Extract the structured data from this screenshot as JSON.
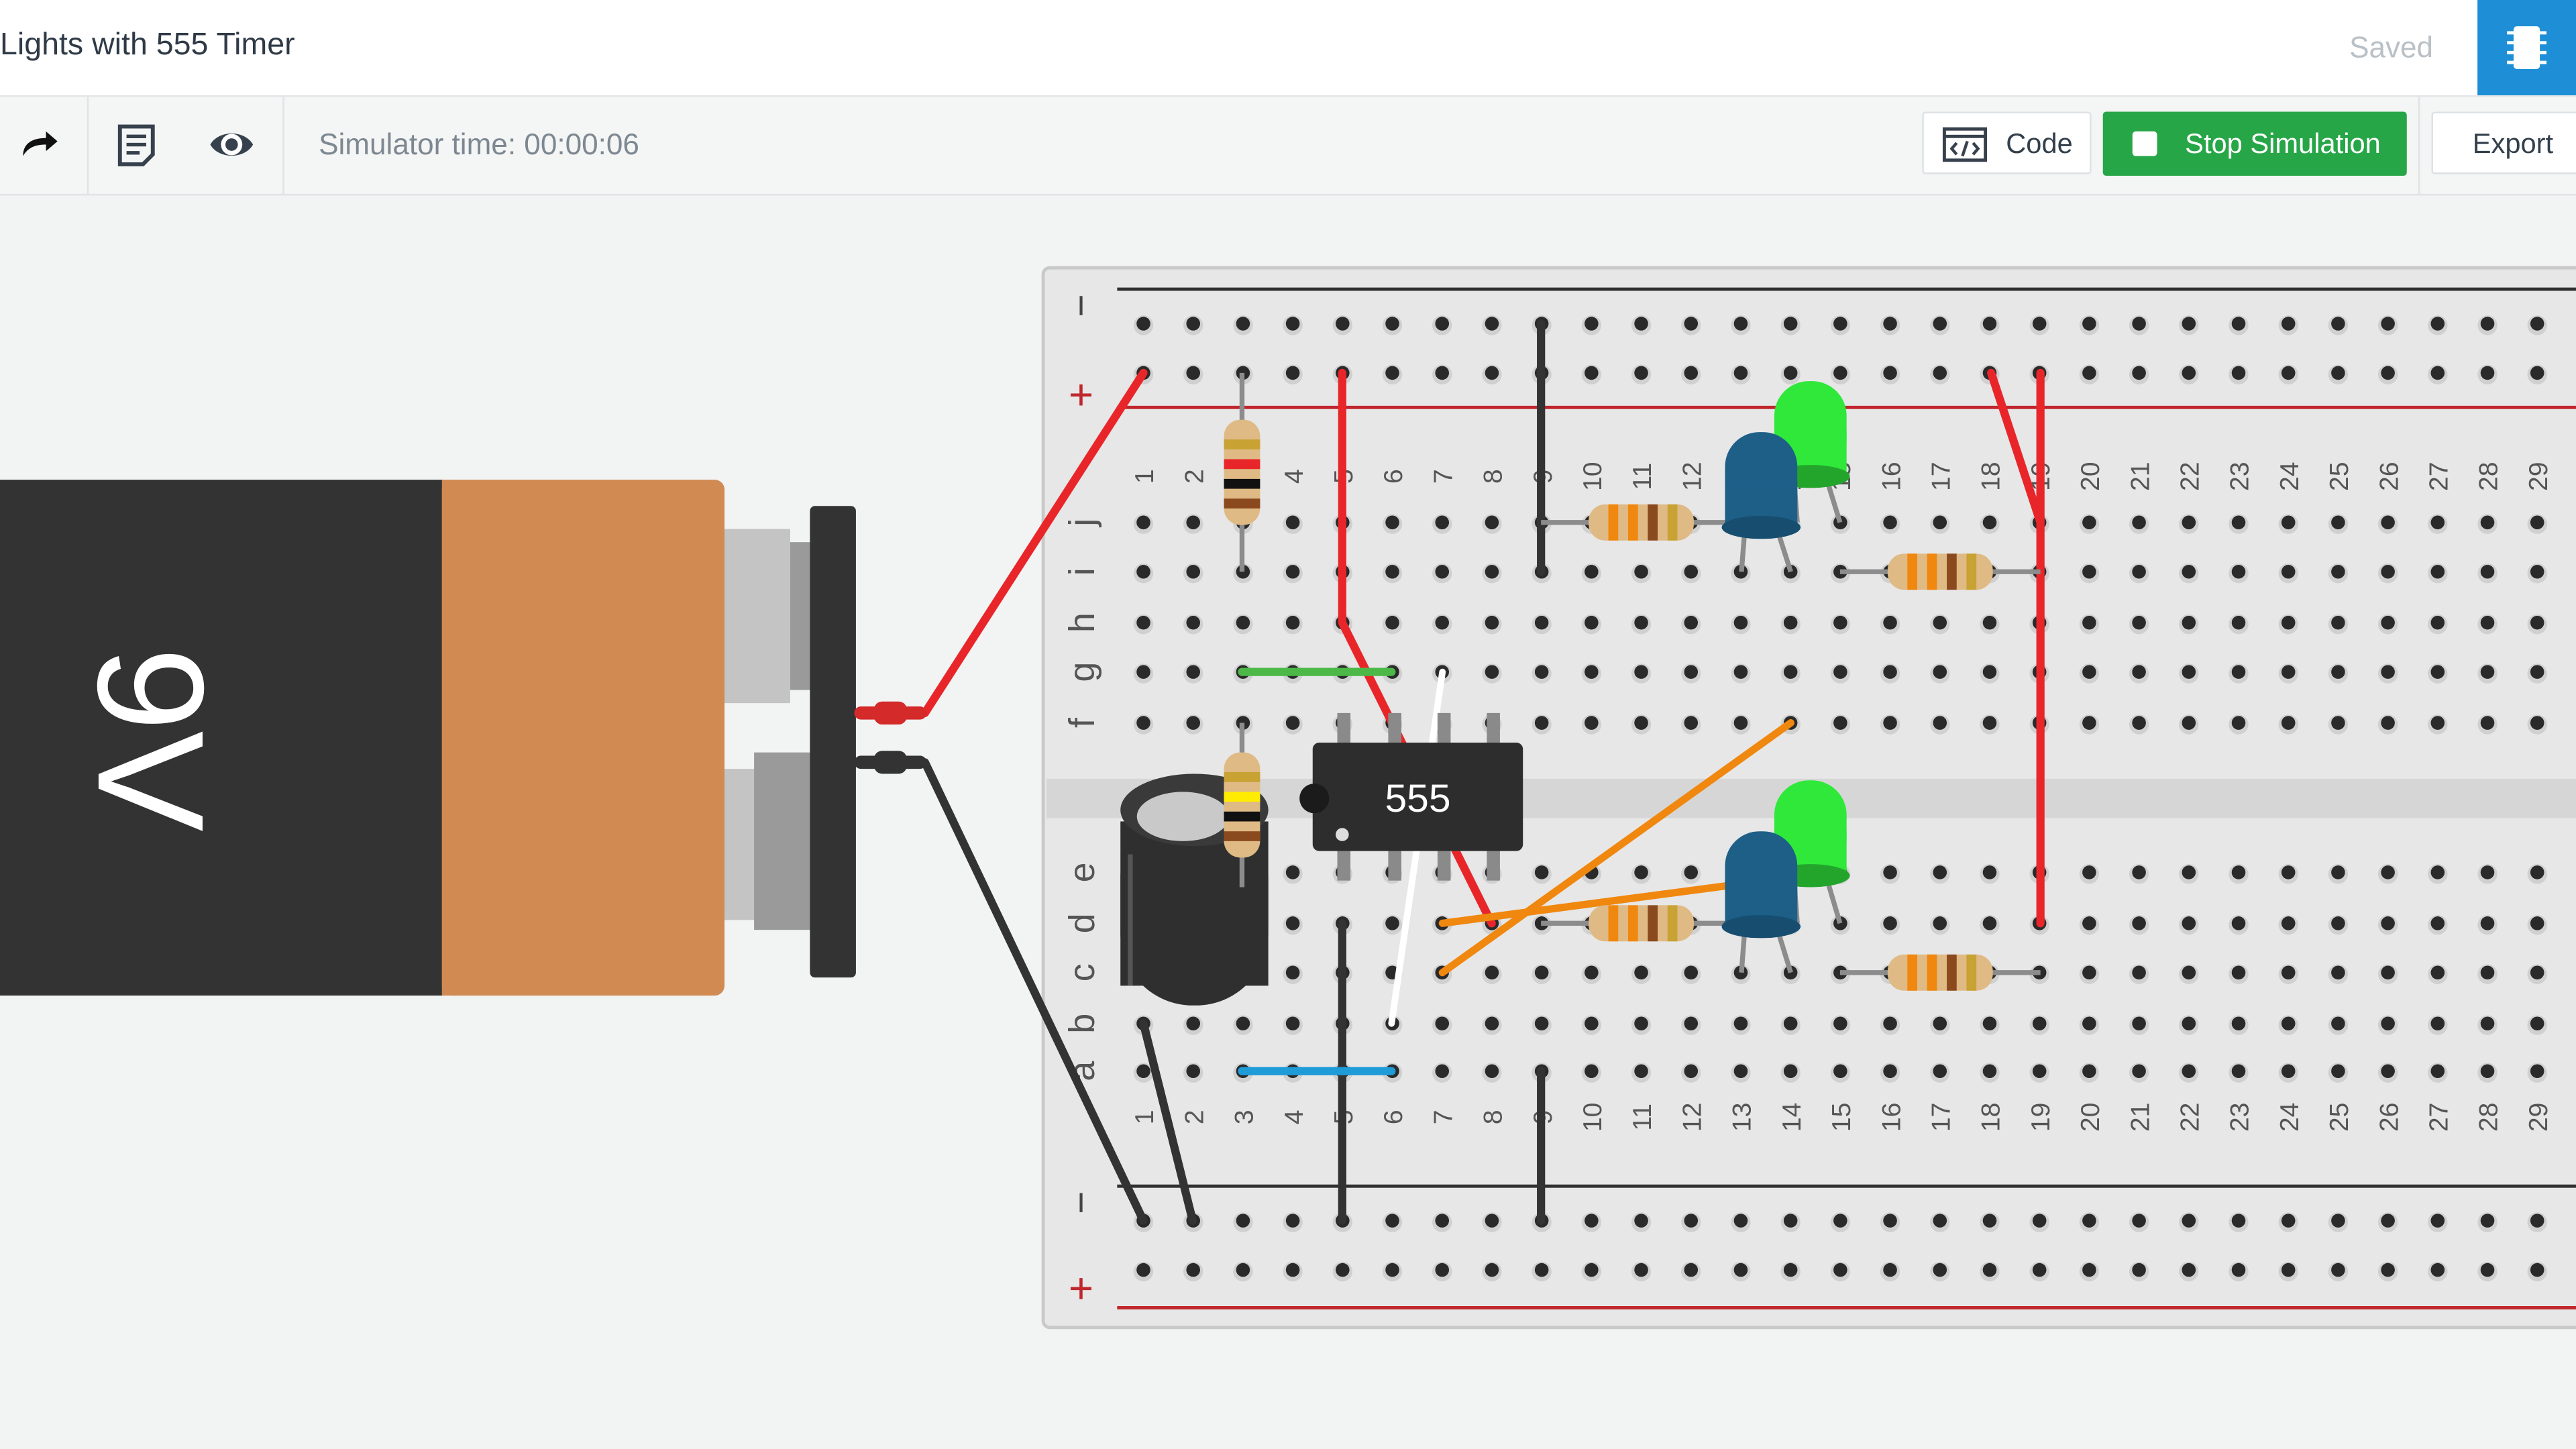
{
  "header": {
    "title": "Lights with 555 Timer",
    "status": "Saved",
    "components_icon": "chip-icon"
  },
  "toolbar": {
    "redo_icon": "redo-icon",
    "notes_icon": "notes-icon",
    "view_icon": "eye-icon",
    "sim_time": "Simulator time: 00:00:06",
    "code_label": "Code",
    "stop_label": "Stop Simulation",
    "export_label": "Export"
  },
  "circuit": {
    "battery_label": "9V",
    "ic_label": "555",
    "rail_minus": "−",
    "rail_plus": "+",
    "row_letters_top": [
      "j",
      "i",
      "h",
      "g",
      "f"
    ],
    "row_letters_bottom": [
      "e",
      "d",
      "c",
      "b",
      "a"
    ],
    "column_numbers": [
      "1",
      "2",
      "3",
      "4",
      "5",
      "6",
      "7",
      "8",
      "9",
      "10",
      "11",
      "12",
      "13",
      "14",
      "15",
      "16",
      "17",
      "18",
      "19",
      "20",
      "21",
      "22",
      "23",
      "24",
      "25",
      "26",
      "27",
      "28",
      "29"
    ]
  },
  "colors": {
    "accent": "#1e8fd6",
    "stop": "#27a648",
    "wire_red": "#e8262a",
    "wire_black": "#333333",
    "wire_orange": "#f0870f",
    "wire_green": "#4cb848",
    "wire_blue": "#1f9bd8",
    "led_green": "#2fe83a",
    "led_blue": "#1d5f87"
  }
}
